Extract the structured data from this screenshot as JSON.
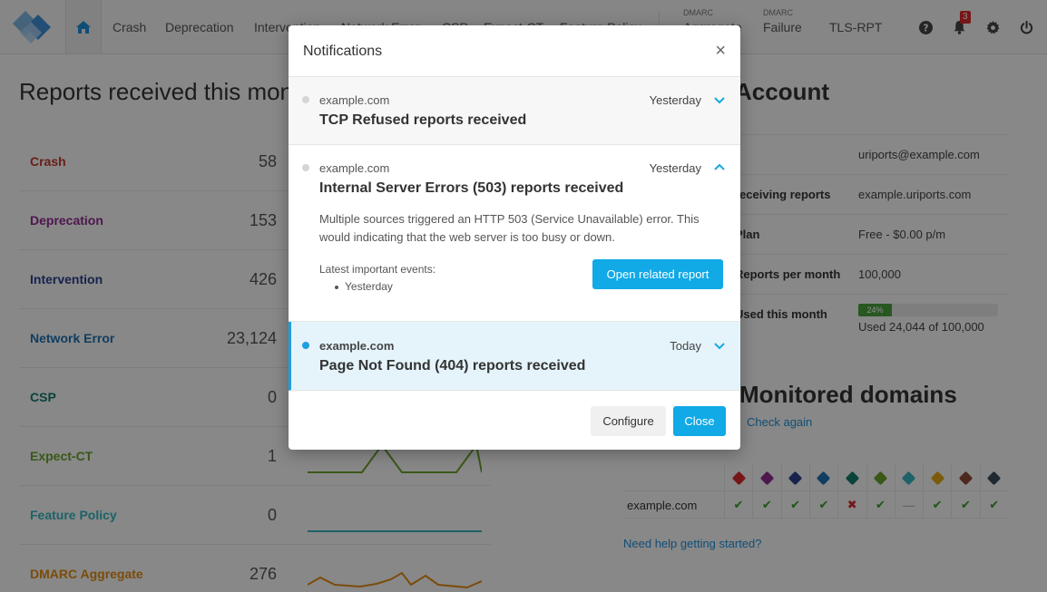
{
  "nav": {
    "items": [
      {
        "label": "Crash"
      },
      {
        "label": "Deprecation"
      },
      {
        "label": "Intervention"
      },
      {
        "label": "Network Error"
      },
      {
        "label": "CSP"
      },
      {
        "label": "Expect-CT"
      },
      {
        "label": "Feature Policy"
      },
      {
        "small": "DMARC",
        "label": "Aggregate"
      },
      {
        "small": "DMARC",
        "label": "Failure"
      },
      {
        "label": "TLS-RPT"
      }
    ],
    "notification_count": "3"
  },
  "page": {
    "title": "Reports received this month",
    "right_title": "Account",
    "metrics": [
      {
        "label": "Crash",
        "value": "58",
        "color": "#c0392b"
      },
      {
        "label": "Deprecation",
        "value": "153",
        "color": "#8e2a8e"
      },
      {
        "label": "Intervention",
        "value": "426",
        "color": "#2c3e8c"
      },
      {
        "label": "Network Error",
        "value": "23,124",
        "color": "#1f6fb0"
      },
      {
        "label": "CSP",
        "value": "0",
        "color": "#137a6b"
      },
      {
        "label": "Expect-CT",
        "value": "1",
        "color": "#6aa12b"
      },
      {
        "label": "Feature Policy",
        "value": "0",
        "color": "#35b2bd"
      },
      {
        "label": "DMARC Aggregate",
        "value": "276",
        "color": "#e08a14"
      }
    ]
  },
  "account": {
    "rows": [
      {
        "key": "",
        "value": "uriports@example.com"
      },
      {
        "key": "receiving reports",
        "value": "example.uriports.com"
      },
      {
        "key": "Plan",
        "value": "Free - $0.00 p/m"
      },
      {
        "key": "Reports per month",
        "value": "100,000"
      }
    ],
    "usage_key": "Used this month",
    "usage_percent": 24,
    "usage_percent_label": "24%",
    "usage_text": "Used 24,044 of 100,000"
  },
  "domains": {
    "title": "Monitored domains",
    "check_again": "Check again",
    "header_colors": [
      "#d9282d",
      "#8e2a8e",
      "#2c3e8c",
      "#1f6fb0",
      "#137a6b",
      "#6aa12b",
      "#35b2bd",
      "#e0a514",
      "#8b4a35",
      "#3d4b58"
    ],
    "rows": [
      {
        "name": "example.com",
        "status": [
          "✔",
          "✔",
          "✔",
          "✔",
          "✖",
          "✔",
          "—",
          "✔",
          "✔",
          "✔"
        ]
      }
    ],
    "help_link": "Need help getting started?"
  },
  "modal": {
    "title": "Notifications",
    "close_glyph": "×",
    "notifications": [
      {
        "source": "example.com",
        "time": "Yesterday",
        "title": "TCP Refused reports received",
        "unread": false
      },
      {
        "source": "example.com",
        "time": "Yesterday",
        "title": "Internal Server Errors (503) reports received",
        "body": "Multiple sources triggered an HTTP 503 (Service Unavailable) error. This would indicating that the web server is too busy or down.",
        "events_label": "Latest important events:",
        "events": [
          "Yesterday"
        ],
        "action_label": "Open related report",
        "unread": false
      },
      {
        "source": "example.com",
        "time": "Today",
        "title": "Page Not Found (404) reports received",
        "unread": true
      }
    ],
    "configure_label": "Configure",
    "close_label": "Close"
  },
  "colors": {
    "accent": "#11a9e6",
    "unread_bg": "#e5f4fb",
    "unread_dot": "#1e9fe0"
  }
}
